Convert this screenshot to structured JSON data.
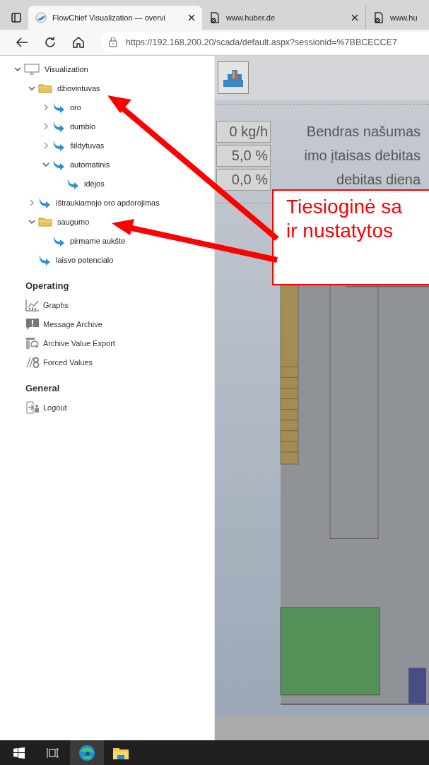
{
  "browser": {
    "tabs": [
      {
        "title": "FlowChief Visualization — overvi",
        "selected": true,
        "kind": "globe"
      },
      {
        "title": "www.huber.de",
        "selected": false,
        "kind": "document"
      },
      {
        "title": "www.hu",
        "selected": false,
        "kind": "document"
      }
    ],
    "address_bar": {
      "url": "https://192.168.200.20/scada/default.aspx?sessionid=%7BBCECCE7"
    }
  },
  "sidebar": {
    "tree": [
      {
        "label": "Visualization",
        "kind": "monitor",
        "expandable": true,
        "expanded": true,
        "children": [
          {
            "label": "džiovintuvas",
            "kind": "folder",
            "expandable": true,
            "expanded": true,
            "children": [
              {
                "label": "oro",
                "kind": "arrow",
                "expandable": true,
                "expanded": false
              },
              {
                "label": "dumblo",
                "kind": "arrow",
                "expandable": true,
                "expanded": false
              },
              {
                "label": "šildytuvas",
                "kind": "arrow",
                "expandable": true,
                "expanded": false
              },
              {
                "label": "automatinis",
                "kind": "arrow",
                "expandable": true,
                "expanded": true,
                "children": [
                  {
                    "label": "idėjos",
                    "kind": "arrow",
                    "expandable": false,
                    "expanded": false
                  }
                ]
              }
            ]
          },
          {
            "label": "ištraukiamojo oro apdorojimas",
            "kind": "arrow",
            "expandable": true,
            "expanded": false
          },
          {
            "label": "saugumo",
            "kind": "folder",
            "expandable": true,
            "expanded": true,
            "children": [
              {
                "label": "pirmame aukšte",
                "kind": "arrow",
                "expandable": false,
                "expanded": false
              }
            ]
          },
          {
            "label": "laisvo potencialo",
            "kind": "arrow",
            "expandable": false,
            "expanded": false
          }
        ]
      }
    ],
    "sections": [
      {
        "heading": "Operating",
        "items": [
          {
            "label": "Graphs",
            "kind": "chart"
          },
          {
            "label": "Message Archive",
            "kind": "alert"
          },
          {
            "label": "Archive Value Export",
            "kind": "export"
          },
          {
            "label": "Forced Values",
            "kind": "forced"
          }
        ]
      },
      {
        "heading": "General",
        "items": [
          {
            "label": "Logout",
            "kind": "logout"
          }
        ]
      }
    ]
  },
  "main": {
    "values": [
      {
        "value": "0 kg/h",
        "label": "Bendras našumas"
      },
      {
        "value": "5,0 %",
        "label": "imo įtaisas debitas"
      },
      {
        "value": "0,0 %",
        "label": "debitas diena"
      }
    ]
  },
  "annotation": {
    "lines": [
      "Tiesioginė sa",
      "ir nustatytos"
    ]
  },
  "taskbar": {
    "items": [
      {
        "kind": "windows",
        "selected": false
      },
      {
        "kind": "task-view",
        "selected": false
      },
      {
        "kind": "edge",
        "selected": true
      },
      {
        "kind": "explorer",
        "selected": false
      }
    ]
  }
}
